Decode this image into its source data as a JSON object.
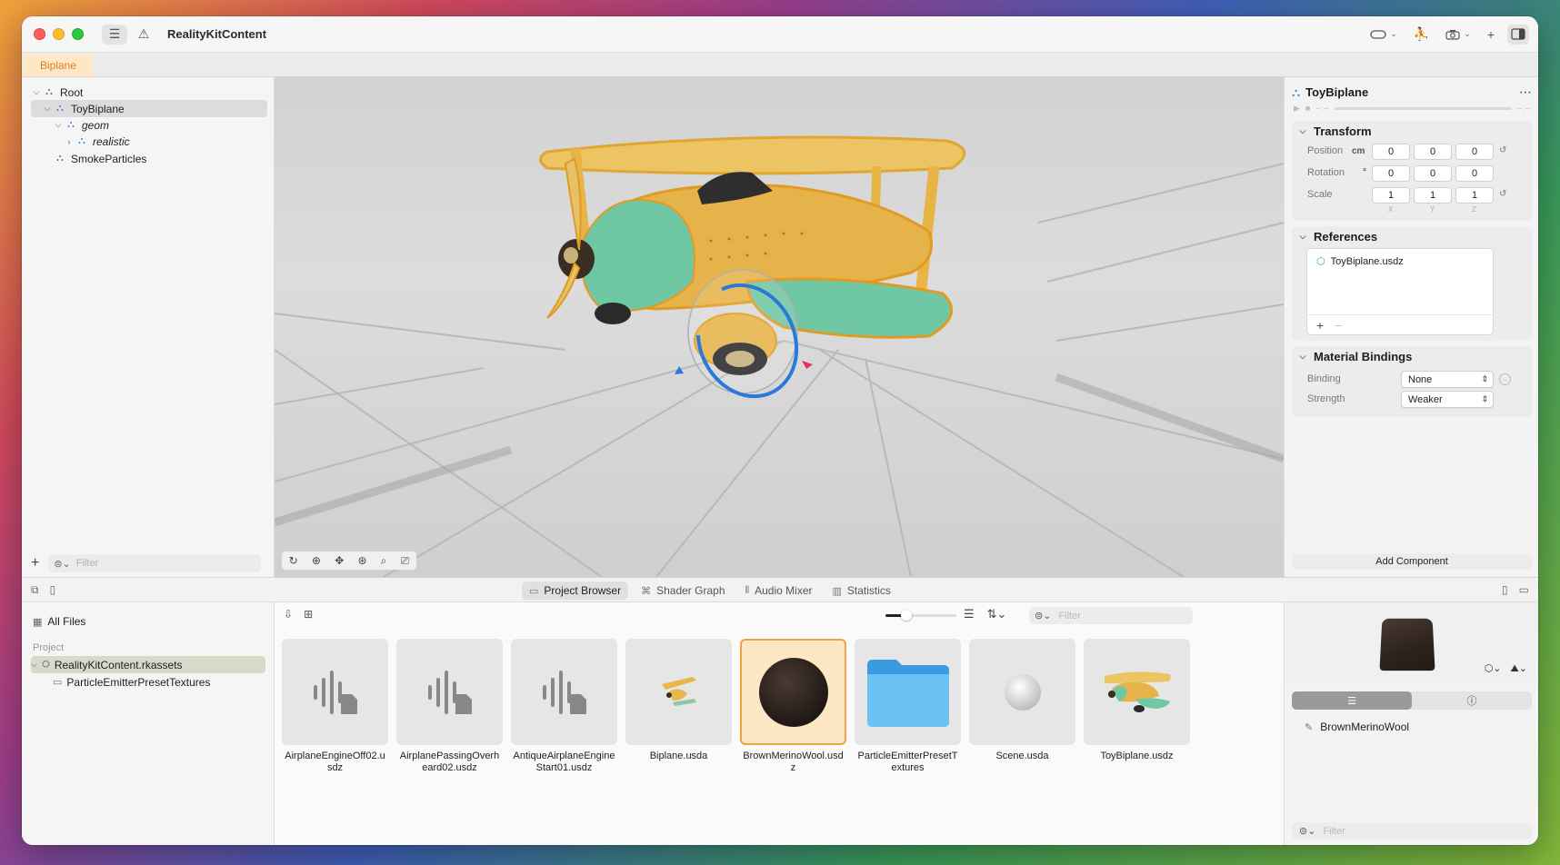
{
  "window": {
    "title": "RealityKitContent",
    "toolbar_icons": [
      "sidebar-toggle-icon",
      "warning-icon",
      "headset-icon",
      "person-hand-icon",
      "camera-icon",
      "plus-icon",
      "inspector-toggle-icon"
    ]
  },
  "scene_tabs": [
    {
      "label": "Biplane",
      "active": true
    }
  ],
  "hierarchy": {
    "items": [
      {
        "label": "Root",
        "level": 0,
        "expanded": true,
        "italic": false
      },
      {
        "label": "ToyBiplane",
        "level": 1,
        "expanded": true,
        "selected": true,
        "italic": false
      },
      {
        "label": "geom",
        "level": 2,
        "expanded": true,
        "italic": true
      },
      {
        "label": "realistic",
        "level": 3,
        "expanded": false,
        "italic": true
      },
      {
        "label": "SmokeParticles",
        "level": 1,
        "italic": false
      }
    ],
    "filter_placeholder": "Filter"
  },
  "inspector": {
    "entity_name": "ToyBiplane",
    "anim_time_start": "--:--",
    "anim_time_end": "--:--",
    "transform": {
      "title": "Transform",
      "position_label": "Position",
      "position_unit": "cm",
      "position": [
        "0",
        "0",
        "0"
      ],
      "rotation_label": "Rotation",
      "rotation_unit": "°",
      "rotation": [
        "0",
        "0",
        "0"
      ],
      "scale_label": "Scale",
      "scale": [
        "1",
        "1",
        "1"
      ],
      "axes": [
        "X",
        "Y",
        "Z"
      ]
    },
    "references": {
      "title": "References",
      "items": [
        "ToyBiplane.usdz"
      ]
    },
    "materials": {
      "title": "Material Bindings",
      "binding_label": "Binding",
      "binding_value": "None",
      "strength_label": "Strength",
      "strength_value": "Weaker"
    },
    "add_component": "Add Component"
  },
  "bottom_tabs": [
    {
      "label": "Project Browser",
      "icon": "folder-icon",
      "active": true
    },
    {
      "label": "Shader Graph",
      "icon": "nodes-icon",
      "active": false
    },
    {
      "label": "Audio Mixer",
      "icon": "sliders-icon",
      "active": false
    },
    {
      "label": "Statistics",
      "icon": "chart-icon",
      "active": false
    }
  ],
  "file_sidebar": {
    "all_files": "All Files",
    "project_header": "Project",
    "items": [
      {
        "label": "RealityKitContent.rkassets",
        "selected": true
      },
      {
        "label": "ParticleEmitterPresetTextures",
        "selected": false
      }
    ]
  },
  "browser": {
    "filter_placeholder": "Filter",
    "zoom_fraction": 0.3,
    "files": [
      {
        "name": "AirplaneEngineOff02.usdz",
        "kind": "audio"
      },
      {
        "name": "AirplanePassingOverheard02.usdz",
        "kind": "audio"
      },
      {
        "name": "AntiqueAirplaneEngineStart01.usdz",
        "kind": "audio"
      },
      {
        "name": "Biplane.usda",
        "kind": "plane-small"
      },
      {
        "name": "BrownMerinoWool.usdz",
        "kind": "material",
        "selected": true
      },
      {
        "name": "ParticleEmitterPresetTextures",
        "kind": "folder"
      },
      {
        "name": "Scene.usda",
        "kind": "sphere"
      },
      {
        "name": "ToyBiplane.usdz",
        "kind": "plane-large"
      }
    ]
  },
  "preview": {
    "material_name": "BrownMerinoWool",
    "filter_placeholder": "Filter"
  },
  "colors": {
    "accent_orange": "#f0a340",
    "selection_blue": "#2f7ee6",
    "plane_yellow": "#eab94a",
    "plane_teal": "#6cc6a6"
  }
}
